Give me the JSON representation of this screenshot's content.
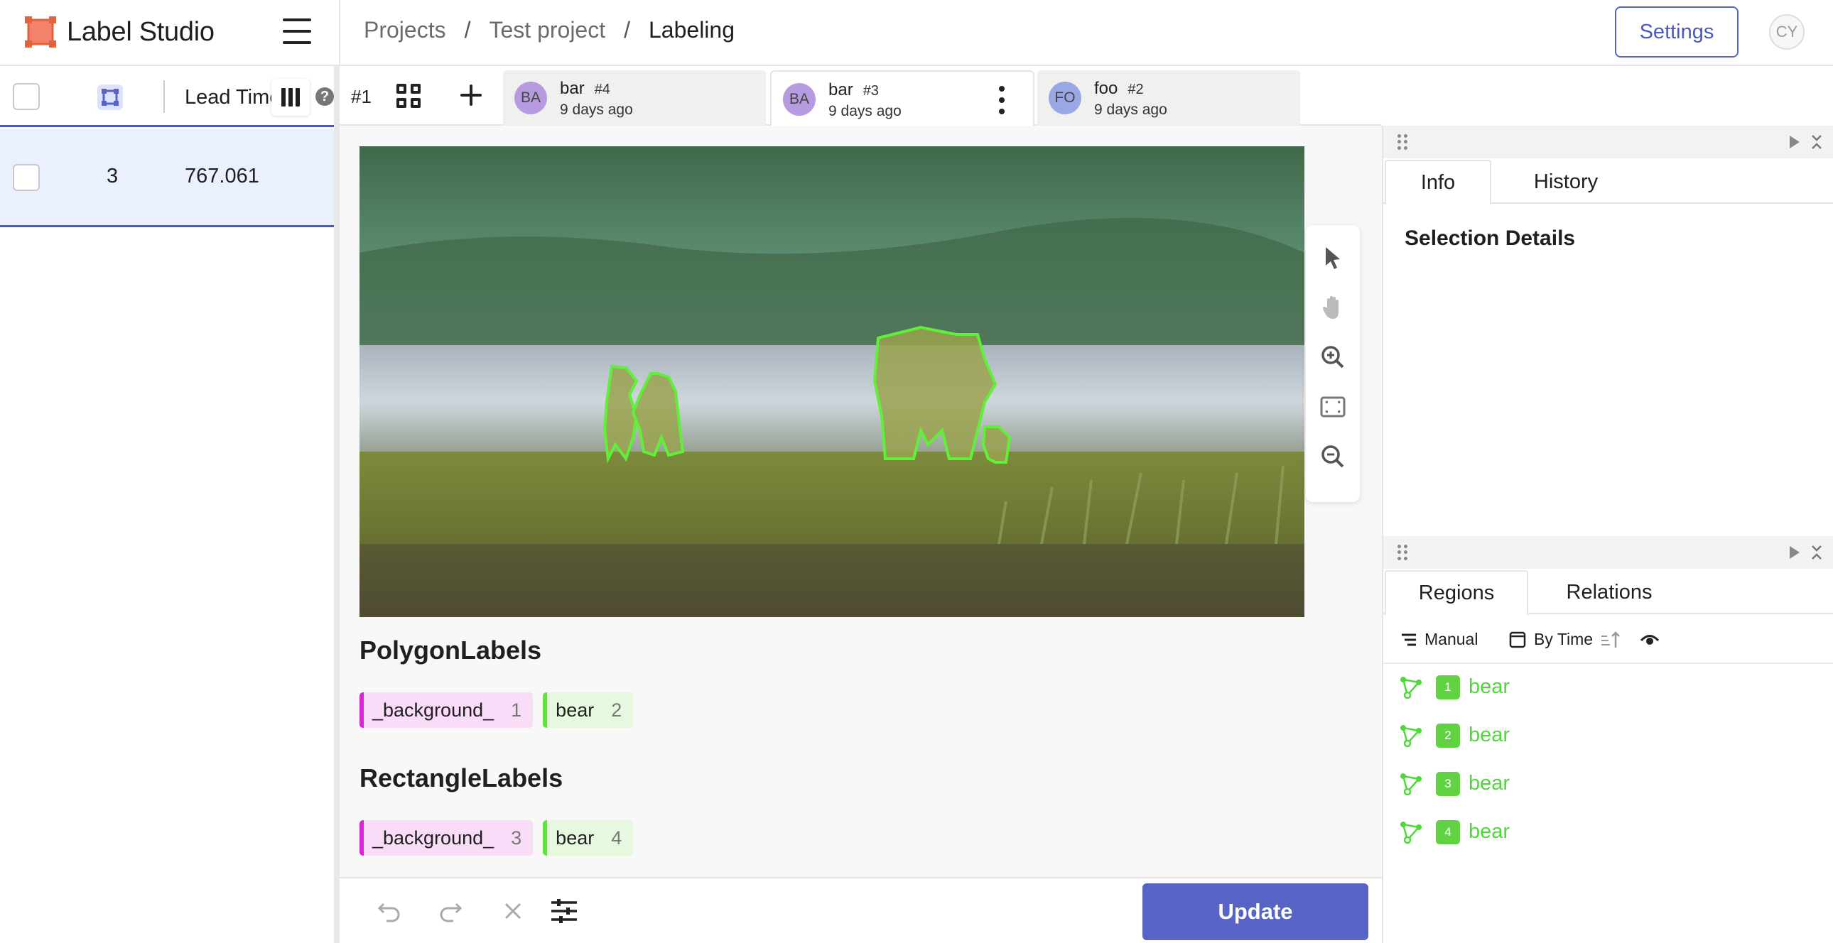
{
  "app": {
    "title": "Label Studio"
  },
  "breadcrumb": {
    "projects": "Projects",
    "sep": "/",
    "project": "Test project",
    "current": "Labeling"
  },
  "header": {
    "settings_label": "Settings",
    "user_initials": "CY"
  },
  "table": {
    "column_title": "Lead Time",
    "help": "?",
    "rows": [
      {
        "id": "3",
        "lead_time": "767.061"
      }
    ]
  },
  "annotations": {
    "task_label": "#1",
    "tabs": [
      {
        "initials": "BA",
        "name": "bar",
        "number": "#4",
        "time": "9 days ago",
        "avatar_color": "#b79be0"
      },
      {
        "initials": "BA",
        "name": "bar",
        "number": "#3",
        "time": "9 days ago",
        "avatar_color": "#b79be0"
      },
      {
        "initials": "FO",
        "name": "foo",
        "number": "#2",
        "time": "9 days ago",
        "avatar_color": "#9aa7e6"
      }
    ]
  },
  "labels": {
    "polygon_title": "PolygonLabels",
    "polygon": [
      {
        "name": "_background_",
        "hotkey": "1",
        "color": "#d626d6",
        "bg": "#f8dcf8"
      },
      {
        "name": "bear",
        "hotkey": "2",
        "color": "#5ee63a",
        "bg": "#e6f9df"
      }
    ],
    "rectangle_title": "RectangleLabels",
    "rectangle": [
      {
        "name": "_background_",
        "hotkey": "3",
        "color": "#d626d6",
        "bg": "#f8dcf8"
      },
      {
        "name": "bear",
        "hotkey": "4",
        "color": "#5ee63a",
        "bg": "#e6f9df"
      }
    ]
  },
  "footer": {
    "update_label": "Update"
  },
  "info_panel": {
    "tabs": [
      "Info",
      "History"
    ],
    "selection_title": "Selection Details"
  },
  "regions_panel": {
    "tabs": [
      "Regions",
      "Relations"
    ],
    "manual_label": "Manual",
    "sort_label": "By Time",
    "regions": [
      {
        "index": "1",
        "label": "bear"
      },
      {
        "index": "2",
        "label": "bear"
      },
      {
        "index": "3",
        "label": "bear"
      },
      {
        "index": "4",
        "label": "bear"
      }
    ]
  },
  "colors": {
    "accent": "#5764c6",
    "region_green": "#5ee63a"
  }
}
